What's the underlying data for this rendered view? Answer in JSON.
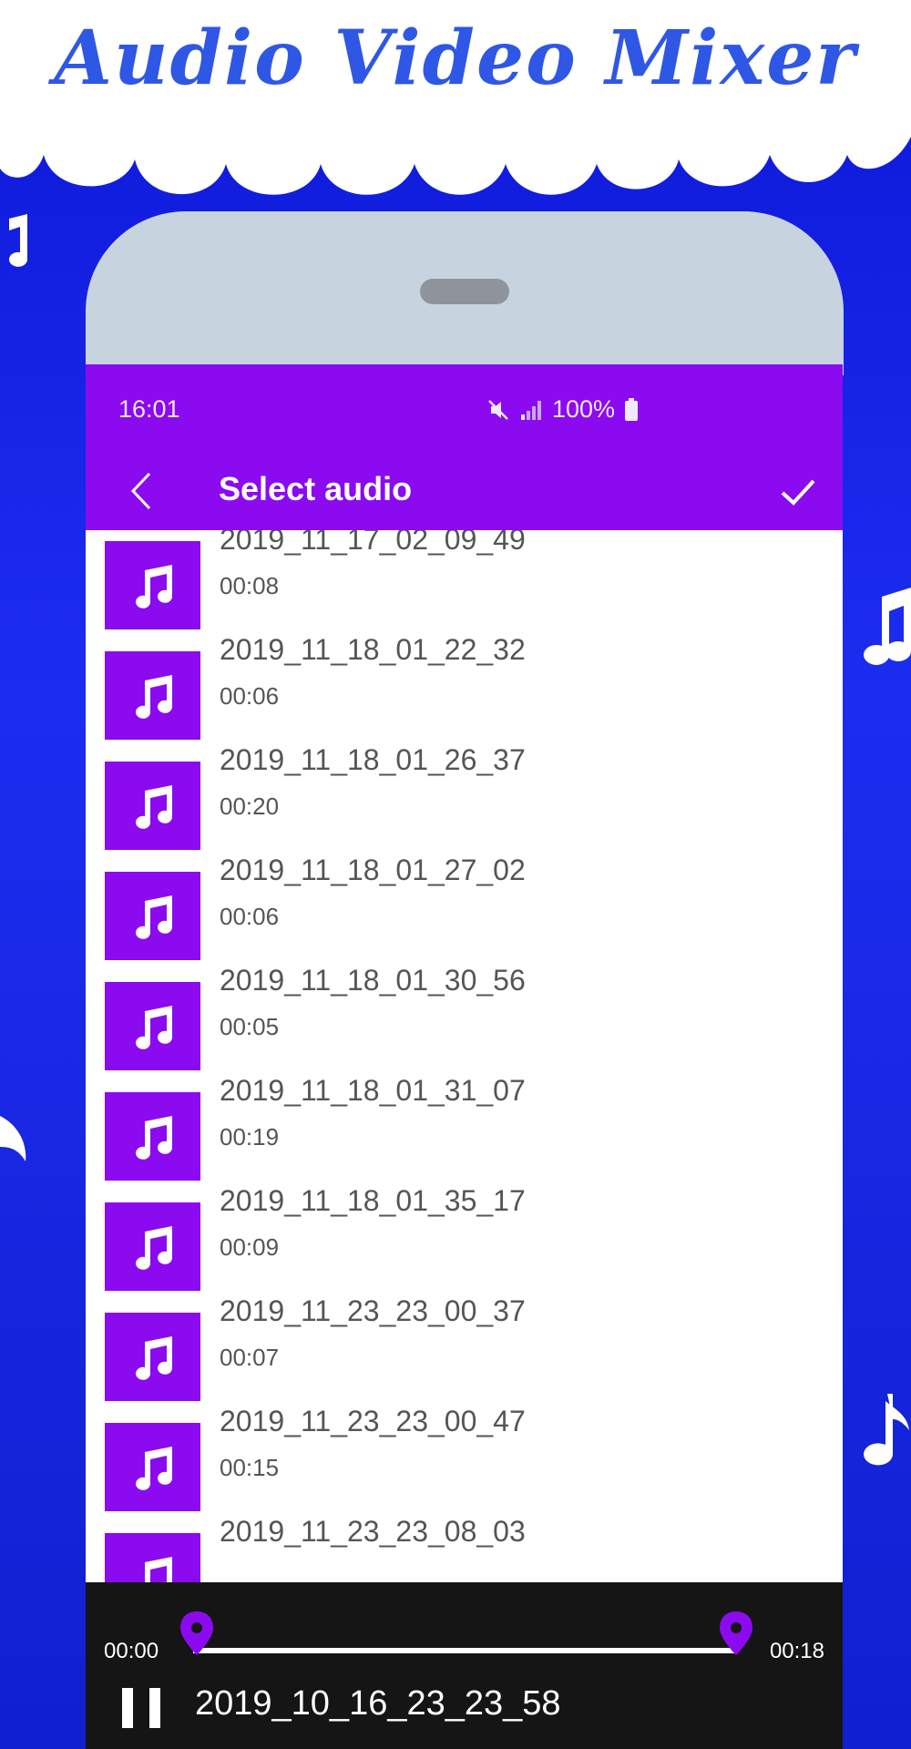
{
  "promo": {
    "title": "Audio Video Mixer"
  },
  "status_bar": {
    "time": "16:01",
    "battery": "100%"
  },
  "app_bar": {
    "title": "Select audio"
  },
  "audio_list": [
    {
      "name": "2019_11_17_02_09_49",
      "duration": "00:08"
    },
    {
      "name": "2019_11_18_01_22_32",
      "duration": "00:06"
    },
    {
      "name": "2019_11_18_01_26_37",
      "duration": "00:20"
    },
    {
      "name": "2019_11_18_01_27_02",
      "duration": "00:06"
    },
    {
      "name": "2019_11_18_01_30_56",
      "duration": "00:05"
    },
    {
      "name": "2019_11_18_01_31_07",
      "duration": "00:19"
    },
    {
      "name": "2019_11_18_01_35_17",
      "duration": "00:09"
    },
    {
      "name": "2019_11_23_23_00_37",
      "duration": "00:07"
    },
    {
      "name": "2019_11_23_23_00_47",
      "duration": "00:15"
    },
    {
      "name": "2019_11_23_23_08_03",
      "duration": ""
    }
  ],
  "player": {
    "start_time": "00:00",
    "end_time": "00:18",
    "now_playing": "2019_10_16_23_23_58",
    "range_start_fraction": 0.0,
    "range_end_fraction": 1.0
  },
  "colors": {
    "accent": "#8b0af0",
    "background_blue": "#1020d0",
    "player_bg": "#151515"
  },
  "icons": {
    "list_item": "music-note-icon",
    "back": "chevron-left-icon",
    "confirm": "checkmark-icon",
    "play_state": "pause-icon",
    "range_handle": "map-pin-icon"
  }
}
